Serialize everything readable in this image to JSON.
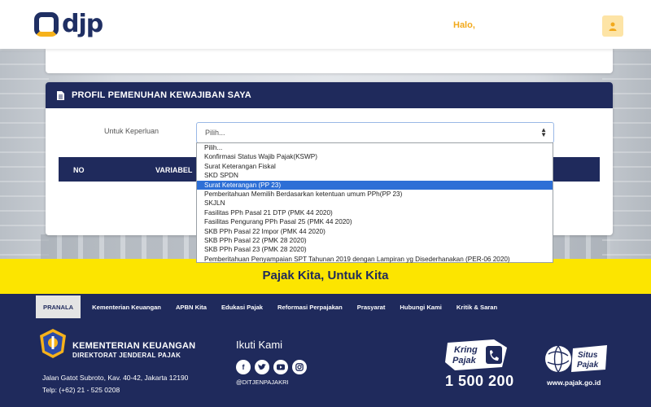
{
  "header": {
    "logo_text": "djp",
    "greeting": "Halo,"
  },
  "card": {
    "title": "PROFIL PEMENUHAN KEWAJIBAN SAYA",
    "purpose_label": "Untuk Keperluan",
    "purpose_select_value": "Pilih...",
    "table_headers": [
      "NO",
      "VARIABEL"
    ]
  },
  "dropdown": {
    "options": [
      "Pilih...",
      "Konfirmasi Status Wajib Pajak(KSWP)",
      "Surat Keterangan Fiskal",
      "SKD SPDN",
      "Surat Keterangan (PP 23)",
      "Pemberitahuan Memilih Berdasarkan ketentuan umum PPh(PP 23)",
      "SKJLN",
      "Fasilitas PPh Pasal 21 DTP (PMK 44 2020)",
      "Fasilitas Pengurang PPh Pasal 25 (PMK 44 2020)",
      "SKB PPh Pasal 22 Impor (PMK 44 2020)",
      "SKB PPh Pasal 22 (PMK 28 2020)",
      "SKB PPh Pasal 23 (PMK 28 2020)",
      "Pemberitahuan Penyampaian SPT Tahunan 2019 dengan Lampiran yg Disederhanakan (PER-06 2020)"
    ],
    "highlighted_index": 4
  },
  "banner": {
    "slogan": "Pajak Kita, Untuk Kita"
  },
  "footer": {
    "nav": [
      "PRANALA",
      "Kementerian Keuangan",
      "APBN Kita",
      "Edukasi Pajak",
      "Reformasi Perpajakan",
      "Prasyarat",
      "Hubungi Kami",
      "Kritik & Saran"
    ],
    "ministry_line1": "KEMENTERIAN KEUANGAN",
    "ministry_line2": "DIREKTORAT JENDERAL PAJAK",
    "address_line1": "Jalan Gatot Subroto, Kav. 40-42, Jakarta 12190",
    "address_line2": "Telp: (+62) 21 - 525 0208",
    "follow_title": "Ikuti Kami",
    "social_handle": "@DITJENPAJAKRI",
    "kring_brand_line1": "Kring",
    "kring_brand_line2": "Pajak",
    "kring_number": "1 500 200",
    "situs_brand_line1": "Situs",
    "situs_brand_line2": "Pajak",
    "situs_url": "www.pajak.go.id"
  },
  "colors": {
    "navy": "#1f2a5c",
    "yellow": "#fce500",
    "accent_orange": "#f2a91b",
    "selection_blue": "#2d6fd6"
  },
  "icons": [
    "user-icon",
    "document-icon",
    "select-caret-icon",
    "facebook-icon",
    "twitter-icon",
    "youtube-icon",
    "instagram-icon",
    "phone-icon",
    "globe-icon",
    "ministry-emblem"
  ]
}
